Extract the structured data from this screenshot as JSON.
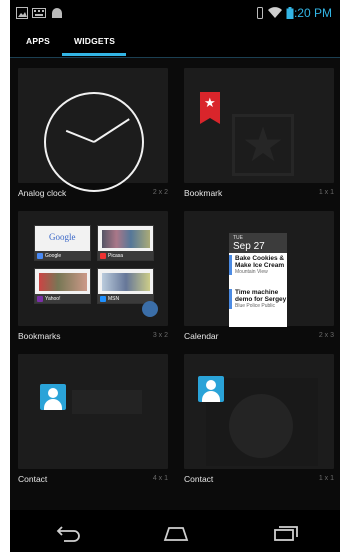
{
  "status_bar": {
    "time": "1:20 PM",
    "accent_color": "#33b5e5"
  },
  "tabs": [
    {
      "label": "APPS",
      "selected": false
    },
    {
      "label": "WIDGETS",
      "selected": true
    }
  ],
  "widgets": [
    {
      "label": "Analog clock",
      "size": "2 x 2"
    },
    {
      "label": "Bookmark",
      "size": "1 x 1"
    },
    {
      "label": "Bookmarks",
      "size": "3 x 2",
      "thumbnails": [
        "Google",
        "Picasa",
        "Yahoo!",
        "MSN"
      ]
    },
    {
      "label": "Calendar",
      "size": "2 x 3",
      "calendar": {
        "day": "TUE",
        "date": "Sep 27",
        "events": [
          {
            "title": "Bake Cookies & Make Ice Cream",
            "sub": "Mountain View"
          },
          {
            "title": "Time machine demo for Sergey",
            "sub": "Blue Police Public"
          }
        ]
      }
    },
    {
      "label": "Contact",
      "size": "4 x 1"
    },
    {
      "label": "Contact",
      "size": "1 x 1"
    }
  ],
  "nav_bar": {
    "buttons": [
      "back-icon",
      "home-icon",
      "recent-apps-icon"
    ]
  }
}
